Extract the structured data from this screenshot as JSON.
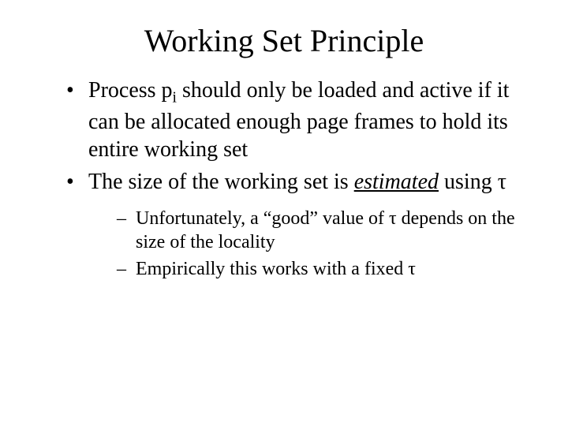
{
  "title": "Working Set Principle",
  "bullets": {
    "b1_pre": "Process p",
    "b1_sub": "i",
    "b1_post": " should only be loaded and active if it can be allocated enough page frames to hold its entire working set",
    "b2_pre": "The size of the working set is ",
    "b2_em": "estimated",
    "b2_post": " using τ"
  },
  "subbullets": {
    "s1": "Unfortunately, a “good” value of τ depends on the size of the locality",
    "s2": "Empirically this works with a fixed τ"
  }
}
